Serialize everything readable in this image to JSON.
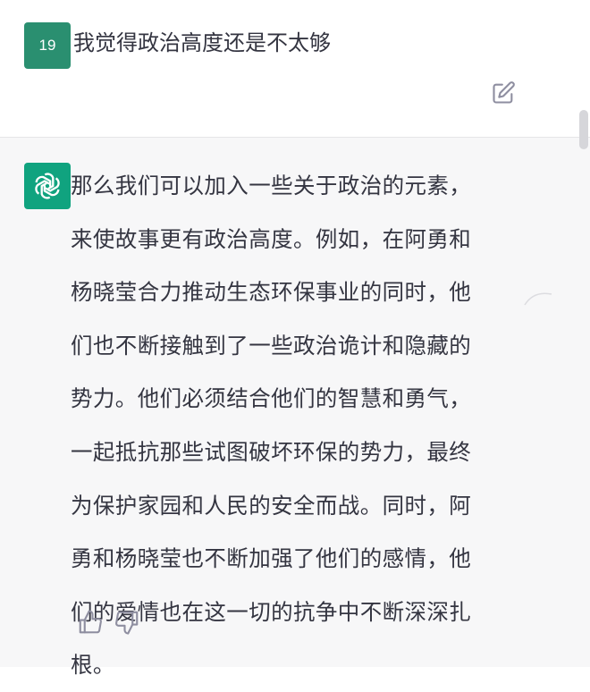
{
  "user_message": {
    "avatar_label": "19",
    "text": "我觉得政治高度还是不太够"
  },
  "assistant_message": {
    "icon": "openai-logo-icon",
    "lines": [
      "那么我们可以加入一些关于政治的元素，",
      "来使故事更有政治高度。例如，在阿勇和",
      "杨晓莹合力推动生态环保事业的同时，他",
      "们也不断接触到了一些政治诡计和隐藏的",
      "势力。他们必须结合他们的智慧和勇气，",
      "一起抵抗那些试图破坏环保的势力，最终",
      "为保护家园和人民的安全而战。同时，阿",
      "勇和杨晓莹也不断加强了他们的感情，他",
      "们的爱情也在这一切的抗争中不断深深扎",
      "根。"
    ]
  },
  "actions": {
    "edit_icon": "edit-icon",
    "thumbs_up_icon": "thumbs-up-icon",
    "thumbs_down_icon": "thumbs-down-icon"
  },
  "colors": {
    "user_avatar_bg": "#2a8f70",
    "assistant_avatar_bg": "#10a37f",
    "assistant_bg": "#f7f7f8",
    "text": "#343541",
    "icon_gray": "#8e8ea0"
  }
}
